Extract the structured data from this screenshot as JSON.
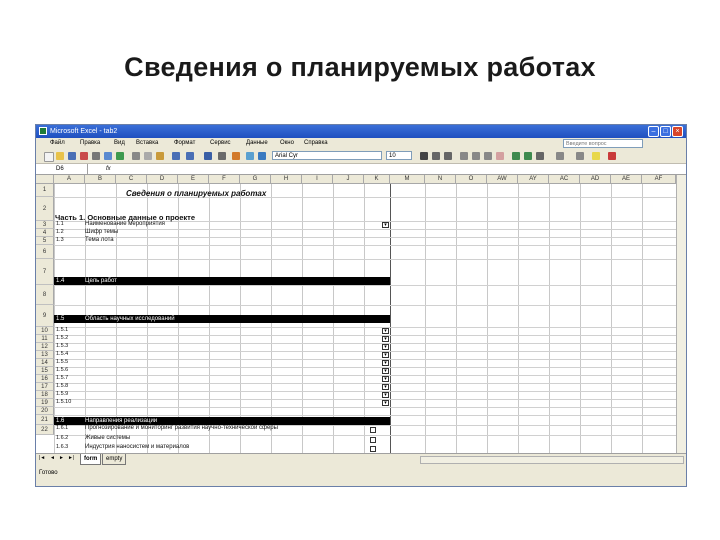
{
  "slide": {
    "title": "Сведения о планируемых работах"
  },
  "window": {
    "title": "Microsoft Excel - tab2"
  },
  "menu": [
    "Файл",
    "Правка",
    "Вид",
    "Вставка",
    "Формат",
    "Сервис",
    "Данные",
    "Окно",
    "Справка"
  ],
  "help_placeholder": "Введите вопрос",
  "toolbar": {
    "font_name": "Arial Cyr",
    "font_size": "10"
  },
  "formula_bar": {
    "name_box": "D6",
    "fx": "fx"
  },
  "columns": [
    "A",
    "B",
    "C",
    "D",
    "E",
    "F",
    "G",
    "H",
    "I",
    "J",
    "K",
    "M",
    "N",
    "O",
    "AW",
    "AY",
    "AC",
    "AD",
    "AE",
    "AF"
  ],
  "rows": [
    "1",
    "2",
    "3",
    "4",
    "5",
    "6",
    "7",
    "8",
    "9",
    "10",
    "11",
    "12",
    "13",
    "14",
    "15",
    "16",
    "17",
    "18",
    "19",
    "20",
    "21",
    "22"
  ],
  "sheet": {
    "header": "Сведения о планируемых работах",
    "part1": "Часть 1. Основные данные о проекте",
    "cells": [
      {
        "num": "1.1",
        "text": "Наименование мероприятия"
      },
      {
        "num": "1.2",
        "text": "Шифр темы"
      },
      {
        "num": "1.3",
        "text": "Тема лота"
      }
    ],
    "goal": {
      "num": "1.4",
      "text": "Цель работ"
    },
    "area": {
      "num": "1.5",
      "text": "Область научных исследований"
    },
    "area_items": [
      "1.5.1",
      "1.5.2",
      "1.5.3",
      "1.5.4",
      "1.5.5",
      "1.5.6",
      "1.5.7",
      "1.5.8",
      "1.5.9",
      "1.5.10"
    ],
    "directions": {
      "num": "1.6",
      "text": "Направления реализации"
    },
    "direction_items": [
      {
        "num": "1.6.1",
        "text": "Прогнозирование и мониторинг развития научно-технической сферы"
      },
      {
        "num": "1.6.2",
        "text": "Живые системы"
      },
      {
        "num": "1.6.3",
        "text": "Индустрия наносистем и материалов"
      }
    ]
  },
  "tabs": [
    "form",
    "empty"
  ],
  "status": "Готово"
}
